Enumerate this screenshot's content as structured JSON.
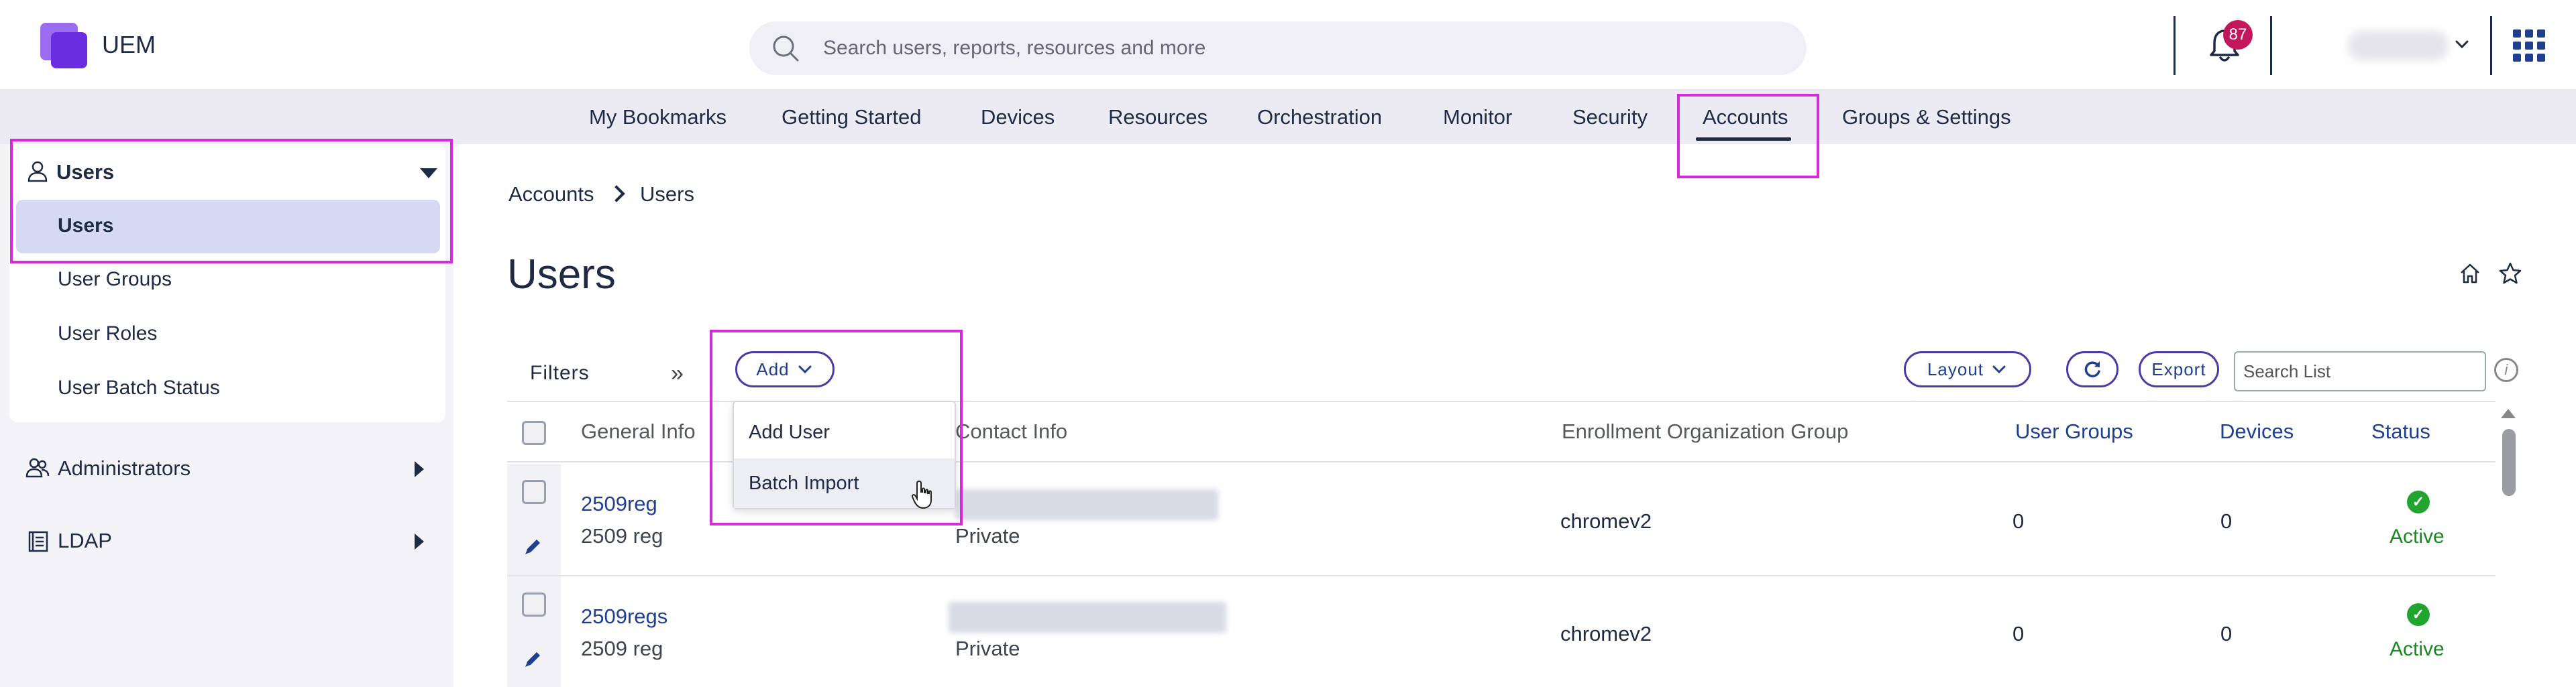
{
  "app": {
    "title": "UEM"
  },
  "search": {
    "placeholder": "Search users, reports, resources and more"
  },
  "notifications": {
    "count": "87"
  },
  "nav": {
    "items": [
      "My Bookmarks",
      "Getting Started",
      "Devices",
      "Resources",
      "Orchestration",
      "Monitor",
      "Security",
      "Accounts",
      "Groups & Settings"
    ],
    "active": "Accounts"
  },
  "sidebar": {
    "users_group": "Users",
    "users_sub": [
      "Users",
      "User Groups",
      "User Roles",
      "User Batch Status"
    ],
    "administrators": "Administrators",
    "ldap": "LDAP"
  },
  "breadcrumb": [
    "Accounts",
    "Users"
  ],
  "page": {
    "title": "Users"
  },
  "toolbar": {
    "filters_label": "Filters",
    "add_label": "Add",
    "layout_label": "Layout",
    "export_label": "Export",
    "search_list_placeholder": "Search List"
  },
  "add_menu": {
    "items": [
      "Add User",
      "Batch Import"
    ],
    "hovered": "Batch Import"
  },
  "table": {
    "columns": [
      "General Info",
      "Contact Info",
      "Enrollment Organization Group",
      "User Groups",
      "Devices",
      "Status"
    ],
    "rows": [
      {
        "username": "2509reg",
        "display_name": "2509 reg",
        "contact_type": "Private",
        "org_group": "chromev2",
        "user_groups": "0",
        "devices": "0",
        "status": "Active"
      },
      {
        "username": "2509regs",
        "display_name": "2509 reg",
        "contact_type": "Private",
        "org_group": "chromev2",
        "user_groups": "0",
        "devices": "0",
        "status": "Active"
      }
    ]
  },
  "colors": {
    "accent": "#1f3f8f",
    "highlight": "#d52bd9",
    "status_ok": "#21a52e",
    "badge": "#c2185b"
  }
}
